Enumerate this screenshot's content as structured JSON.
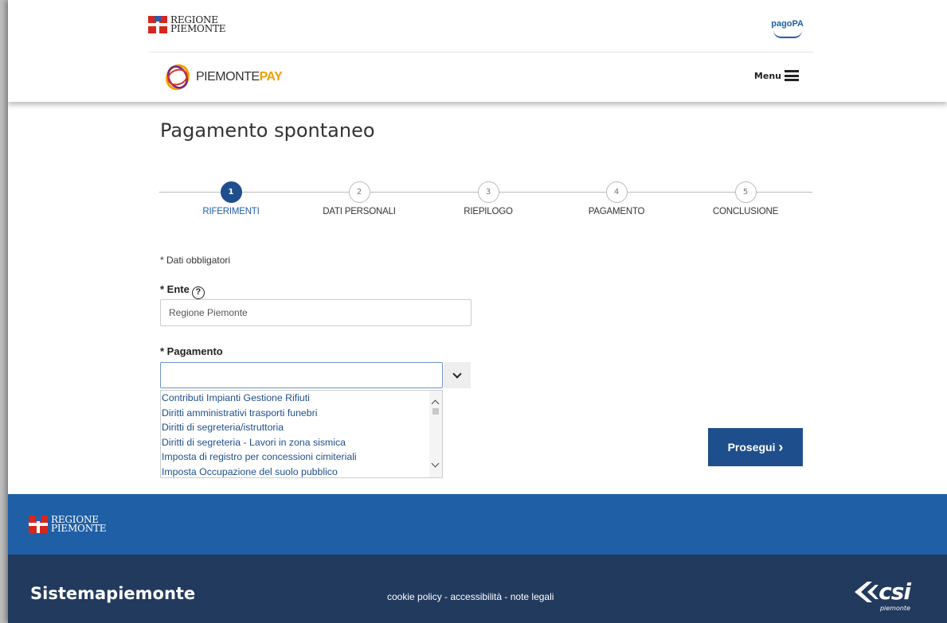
{
  "header": {
    "region_logo_text": [
      "REGIONE",
      "PIEMONTE"
    ],
    "pagopa_label": "pagoPA",
    "brand_prefix": "PIEMONTE",
    "brand_suffix": "PAY",
    "menu_label": "Menu"
  },
  "page": {
    "title": "Pagamento spontaneo"
  },
  "stepper": {
    "steps": [
      {
        "number": "1",
        "label": "RIFERIMENTI",
        "active": true
      },
      {
        "number": "2",
        "label": "DATI PERSONALI",
        "active": false
      },
      {
        "number": "3",
        "label": "RIEPILOGO",
        "active": false
      },
      {
        "number": "4",
        "label": "PAGAMENTO",
        "active": false
      },
      {
        "number": "5",
        "label": "CONCLUSIONE",
        "active": false
      }
    ]
  },
  "form": {
    "required_note": "* Dati obbligatori",
    "ente_label": "* Ente",
    "help_icon": "?",
    "ente_value": "Regione Piemonte",
    "pagamento_label": "* Pagamento",
    "pagamento_value": "",
    "pagamento_options": [
      "Contributi Impianti Gestione Rifiuti",
      "Diritti amministrativi trasporti funebri",
      "Diritti di segreteria/istruttoria",
      "Diritti di segreteria - Lavori in zona sismica",
      "Imposta di registro per concessioni cimiteriali",
      "Imposta Occupazione del suolo pubblico"
    ],
    "submit_label": "Prosegui",
    "submit_icon": "›"
  },
  "footer": {
    "region_logo_text": [
      "REGIONE",
      "PIEMONTE"
    ],
    "site_name": "Sistemapiemonte",
    "links_text": "cookie policy - accessibilità - note legali",
    "csi_label": "csi",
    "csi_sub": "piemonte"
  },
  "colors": {
    "primary": "#1f4e8c",
    "footer_blue": "#1f5fa6",
    "footer_dark": "#213a5e",
    "brand_orange": "#f0a000"
  }
}
